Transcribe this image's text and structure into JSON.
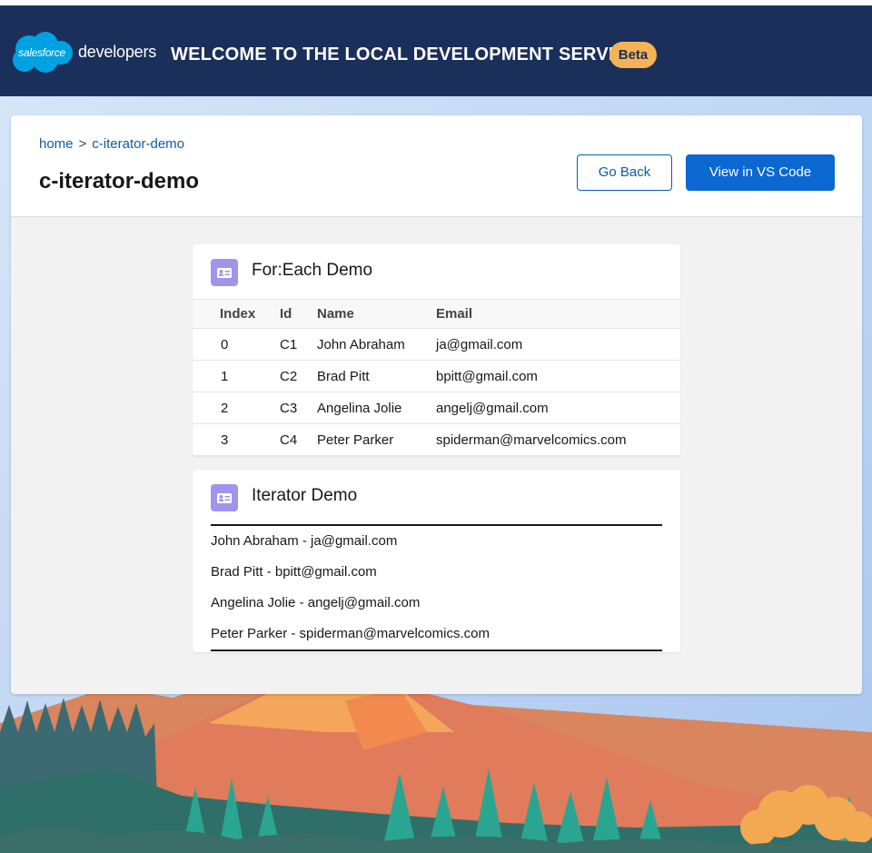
{
  "header": {
    "logo_cloud_text": "salesforce",
    "logo_text": "developers",
    "title": "WELCOME TO THE LOCAL DEVELOPMENT SERVER",
    "badge": "Beta"
  },
  "breadcrumb": {
    "home": "home",
    "separator": ">",
    "current": "c-iterator-demo"
  },
  "page_title": "c-iterator-demo",
  "buttons": {
    "go_back": "Go Back",
    "view_in_vscode": "View in VS Code"
  },
  "foreach_card": {
    "title": "For:Each Demo",
    "columns": [
      "Index",
      "Id",
      "Name",
      "Email"
    ],
    "rows": [
      [
        "0",
        "C1",
        "John Abraham",
        "ja@gmail.com"
      ],
      [
        "1",
        "C2",
        "Brad Pitt",
        "bpitt@gmail.com"
      ],
      [
        "2",
        "C3",
        "Angelina Jolie",
        "angelj@gmail.com"
      ],
      [
        "3",
        "C4",
        "Peter Parker",
        "spiderman@marvelcomics.com"
      ]
    ]
  },
  "iterator_card": {
    "title": "Iterator Demo",
    "items": [
      "John Abraham - ja@gmail.com",
      "Brad Pitt - bpitt@gmail.com",
      "Angelina Jolie - angelj@gmail.com",
      "Peter Parker - spiderman@marvelcomics.com"
    ]
  },
  "colors": {
    "header_bg": "#1b2f5b",
    "brand_cloud": "#00a1e0",
    "badge_bg": "#f6b355",
    "link": "#0b5cab",
    "primary_button": "#0b68d1",
    "card_icon": "#a094ed"
  },
  "icons": {
    "card_icon": "contact-card-icon",
    "logo": "salesforce-cloud-logo"
  }
}
